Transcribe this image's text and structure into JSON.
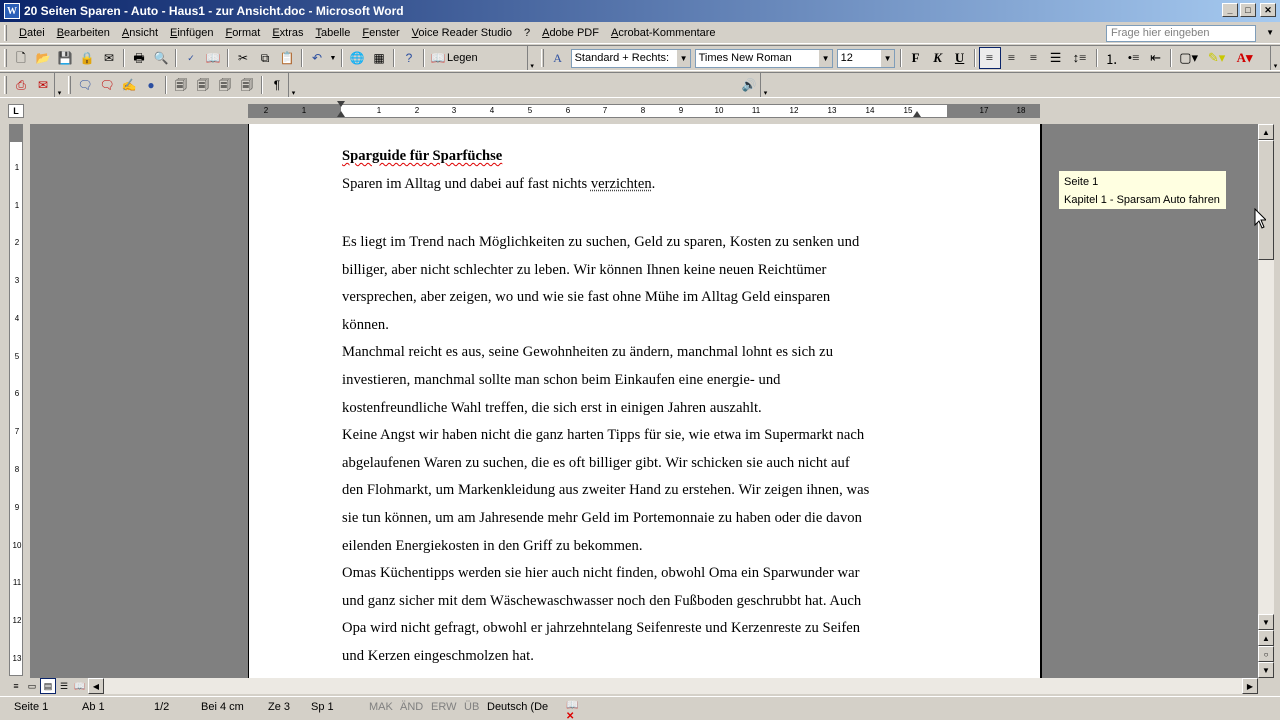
{
  "window": {
    "title": "20 Seiten Sparen - Auto - Haus1 - zur Ansicht.doc - Microsoft Word",
    "icon_letter": "W"
  },
  "menu": {
    "items": [
      "Datei",
      "Bearbeiten",
      "Ansicht",
      "Einfügen",
      "Format",
      "Extras",
      "Tabelle",
      "Fenster",
      "Voice Reader Studio",
      "?",
      "Adobe PDF",
      "Acrobat-Kommentare"
    ],
    "ask_placeholder": "Frage hier eingeben"
  },
  "toolbar": {
    "read_label": "Legen",
    "style_value": "Standard + Rechts:",
    "font_value": "Times New Roman",
    "size_value": "12"
  },
  "ruler": {
    "corner": "L",
    "h_numbers": [
      "2",
      "1",
      "1",
      "2",
      "3",
      "4",
      "5",
      "6",
      "7",
      "8",
      "9",
      "10",
      "11",
      "12",
      "13",
      "14",
      "15",
      "17",
      "18"
    ],
    "v_numbers": [
      "1",
      "1",
      "2",
      "3",
      "4",
      "5",
      "6",
      "7",
      "8",
      "9",
      "10",
      "11",
      "12",
      "13"
    ]
  },
  "document": {
    "heading": "Sparguide für Sparfüchse",
    "subtitle_pre": "Sparen im Alltag und dabei auf fast nichts ",
    "subtitle_squiggle": "verzichten",
    "subtitle_post": ".",
    "lines": [
      "Es liegt im Trend nach Möglichkeiten zu suchen, Geld zu sparen, Kosten zu senken und",
      "billiger, aber nicht schlechter zu leben. Wir können Ihnen keine neuen Reichtümer",
      "versprechen, aber zeigen, wo und wie sie fast ohne Mühe im Alltag Geld einsparen",
      "können.",
      "Manchmal reicht es aus, seine Gewohnheiten zu ändern, manchmal lohnt es sich zu",
      "investieren, manchmal sollte man schon beim Einkaufen eine energie- und",
      "kostenfreundliche Wahl treffen, die sich erst in einigen Jahren auszahlt.",
      "Keine Angst wir haben nicht die ganz harten Tipps für sie, wie etwa im Supermarkt nach",
      "abgelaufenen Waren zu suchen, die es oft billiger gibt. Wir schicken sie auch nicht auf",
      "den Flohmarkt, um Markenkleidung aus zweiter Hand zu erstehen. Wir zeigen ihnen, was",
      "sie tun können, um am Jahresende mehr Geld im Portemonnaie zu haben oder die davon",
      "eilenden Energiekosten in den Griff zu bekommen.",
      "Omas Küchentipps werden sie hier auch nicht finden, obwohl Oma ein Sparwunder war",
      "und ganz sicher mit dem Wäschewaschwasser noch den Fußboden geschrubbt hat. Auch",
      "Opa wird nicht gefragt, obwohl er jahrzehntelang Seifenreste und Kerzenreste zu Seifen",
      "und Kerzen eingeschmolzen hat."
    ]
  },
  "tooltip": {
    "line1": "Seite 1",
    "line2": "Kapitel 1 - Sparsam Auto fahren"
  },
  "status": {
    "page": "Seite  1",
    "section": "Ab  1",
    "pages": "1/2",
    "at": "Bei  4 cm",
    "line": "Ze  3",
    "col": "Sp  1",
    "mak": "MAK",
    "aend": "ÄND",
    "erw": "ERW",
    "ueb": "ÜB",
    "lang": "Deutsch (De"
  },
  "colors": {
    "titlebar_start": "#0a246a",
    "titlebar_end": "#a6caf0",
    "workspace": "#808080",
    "tooltip_bg": "#ffffe1",
    "spell_error": "#dd0000"
  }
}
